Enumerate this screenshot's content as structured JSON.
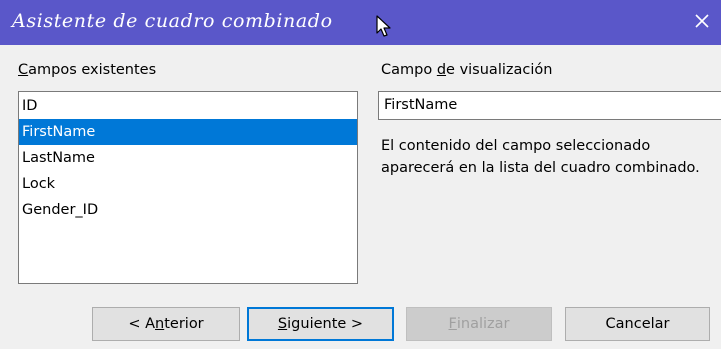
{
  "window": {
    "title": "Asistente de cuadro combinado",
    "close_icon": "close-icon",
    "colors": {
      "titlebar": "#5a57c9",
      "selection": "#0078d7",
      "background": "#f0f0f0"
    }
  },
  "existing_fields": {
    "label_prefix": "",
    "label_accel": "C",
    "label_rest": "ampos existentes",
    "items": [
      {
        "label": "ID",
        "selected": false
      },
      {
        "label": "FirstName",
        "selected": true
      },
      {
        "label": "LastName",
        "selected": false
      },
      {
        "label": "Lock",
        "selected": false
      },
      {
        "label": "Gender_ID",
        "selected": false
      }
    ]
  },
  "display_field": {
    "label_prefix": "Campo ",
    "label_accel": "d",
    "label_rest": "e visualización",
    "value": "FirstName"
  },
  "description": "El contenido del campo seleccionado aparecerá en la lista del cuadro combinado.",
  "buttons": {
    "back": {
      "prefix": "< A",
      "accel": "n",
      "rest": "terior"
    },
    "next": {
      "prefix": "",
      "accel": "S",
      "rest": "iguiente >"
    },
    "finish": {
      "prefix": "",
      "accel": "F",
      "rest": "inalizar",
      "enabled": false
    },
    "cancel": {
      "label": "Cancelar"
    }
  }
}
